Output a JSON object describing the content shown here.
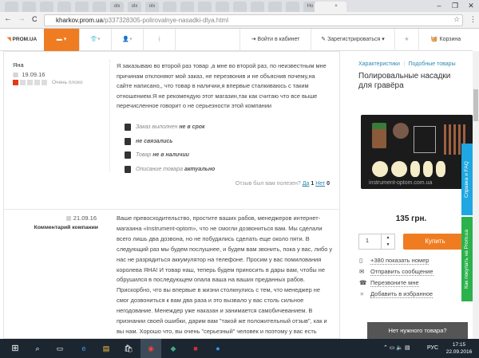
{
  "browser": {
    "tabs": [
      "",
      "",
      "",
      "",
      "",
      "",
      "olx",
      "olx",
      "olx",
      "",
      "",
      "",
      "",
      "",
      "",
      "",
      "",
      "Но",
      "Но",
      ""
    ],
    "url_host": "kharkov.prom.ua",
    "url_path": "/p337328305-polirovalnye-nasadki-dlya.html",
    "back": "←",
    "forward": "→",
    "reload": "C",
    "close_tab": "×",
    "minimize": "–",
    "maximize": "❐",
    "close": "✕"
  },
  "nav": {
    "logo": "PROM.UA",
    "login": "Войти в кабинет",
    "register": "Зарегистрироваться",
    "cart": "Корзина"
  },
  "review": {
    "author": "Яна",
    "date": "19.09.16",
    "rating": 1,
    "rating_max": 5,
    "rating_label": "Очень плохо",
    "text": "Я заказываю во второй раз товар ,а мне во второй раз, по неизвестным мне причинам отклоняют мой заказ, не перезвонив и не объяснив почему,на сайте написано,, что товар в наличии,я впервые сталкиваюсь с таким отношением.Я не рекомендую этот магазин,так как считаю что все выше перечисленное говорит о не серьезности этой компании",
    "features": [
      {
        "label": "Заказ выполнен",
        "value": "не в срок"
      },
      {
        "label": "",
        "value": "не связались"
      },
      {
        "label": "Товар",
        "value": "не в наличии"
      },
      {
        "label": "Описание товара",
        "value": "актуально"
      }
    ],
    "helpful_q": "Отзыв был вам полезен?",
    "yes": "Да",
    "yes_count": "1",
    "no": "Нет",
    "no_count": "0"
  },
  "reply": {
    "date": "21.09.16",
    "label": "Комментарий компании",
    "text": "Ваше превосходительство, простите ваших рабов, менеджеров интернет-магазина «Instrument-optom», что не смогли дозвониться вам. Мы сделали всего лишь два дозвона, но не побудились сделать еще около пяти. В следующий раз мы будем послушнее, и будем вам звонить, пока у вас, либо у нас не разрядиться аккумулятор на телефоне. Просим у вас помилования королева ЯНА! И товар наш, теперь будем приносить в дары вам, чтобы не обрушился в последующем опала ваша на ваших преданных рабов. Прискорбно, что вы впервые в жизни столкнулись с тем, что менеджер не смог дозвониться к вам два раза и это вызвало у вас столь сильное негодование. Менеждер уже наказан и занимается самобичеванием. В признании своей ошибки, дарим вам \"такой же положительный отзыв\", как и вы нам. Хорошо что, вы очень \"серьезный\" человек и поэтому у вас есть огромное количество времени писать данные высказывания. Дай вам Бог здоровья."
  },
  "product": {
    "links": [
      "Характеристики",
      "Подобные товары"
    ],
    "title": "Полировальные насадки для гравёра",
    "watermark": "instrument-optom.com.ua",
    "price": "135 грн.",
    "qty": "1",
    "buy": "Купить",
    "actions": [
      "+380 показать номер",
      "Отправить сообщение",
      "Перезвоните мне",
      "Добавить в избранное"
    ],
    "banner": "Нет нужного товара?"
  },
  "side_tabs": [
    "Справка и FAQ",
    "Как покупать на Prom.ua"
  ],
  "taskbar": {
    "lang": "РУС",
    "time": "17:15",
    "date": "22.09.2016"
  },
  "colors": {
    "accent": "#f07c22",
    "link": "#2a8ab5",
    "help": "#1ea7e1",
    "buy_guide": "#2bb24c"
  }
}
